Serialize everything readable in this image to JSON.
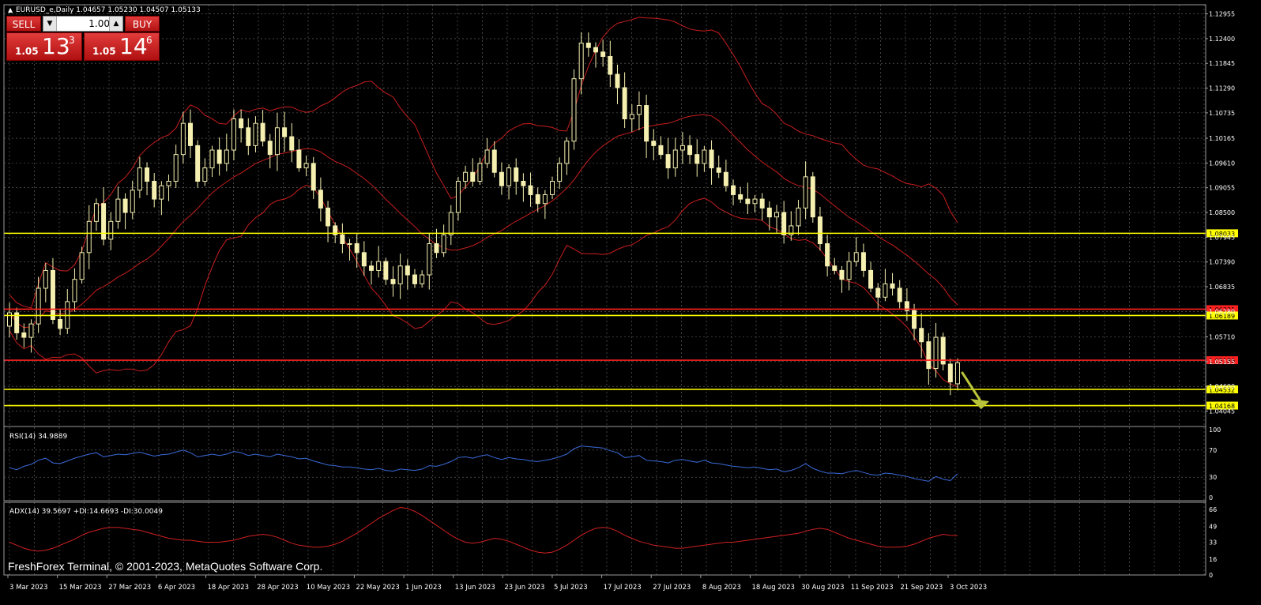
{
  "header": {
    "symbol_info": "EURUSD_e,Daily  1.04657 1.05230 1.04507 1.05133"
  },
  "trade_panel": {
    "sell_label": "SELL",
    "buy_label": "BUY",
    "lot_value": "1.00",
    "bid_prefix": "1.05",
    "bid_big": "13",
    "bid_sup": "3",
    "ask_prefix": "1.05",
    "ask_big": "14",
    "ask_sup": "6"
  },
  "watermark": "FreshForex Terminal, © 2001-2023, MetaQuotes Software Corp.",
  "colors": {
    "background": "#000000",
    "grid": "#6e6e6e",
    "candle": "#f5f0b0",
    "bands": "#c81e1e",
    "support": "#ffff00",
    "resistance": "#ff2020",
    "rsi_line": "#3a6ad8",
    "adx_line": "#d02020",
    "arrow": "#b9c43a"
  },
  "chart_data": {
    "type": "candlestick",
    "symbol": "EURUSD_e",
    "timeframe": "Daily",
    "ohlc_last": {
      "open": 1.04657,
      "high": 1.0523,
      "low": 1.04507,
      "close": 1.05133
    },
    "ylim": [
      1.0377,
      1.1316
    ],
    "y_ticks": [
      1.12955,
      1.124,
      1.11845,
      1.1129,
      1.10735,
      1.10165,
      1.0961,
      1.09055,
      1.085,
      1.07945,
      1.0739,
      1.06835,
      1.0628,
      1.0571,
      1.05155,
      1.046,
      1.04045
    ],
    "x_labels": [
      "3 Mar 2023",
      "15 Mar 2023",
      "27 Mar 2023",
      "6 Apr 2023",
      "18 Apr 2023",
      "28 Apr 2023",
      "10 May 2023",
      "22 May 2023",
      "1 Jun 2023",
      "13 Jun 2023",
      "23 Jun 2023",
      "5 Jul 2023",
      "17 Jul 2023",
      "27 Jul 2023",
      "8 Aug 2023",
      "18 Aug 2023",
      "30 Aug 2023",
      "11 Sep 2023",
      "21 Sep 2023",
      "3 Oct 2023"
    ],
    "horizontal_levels": [
      {
        "price": 1.08033,
        "label": "1.08033",
        "color": "#ffff00"
      },
      {
        "price": 1.06331,
        "label": "1.06331",
        "color": "#ff2020"
      },
      {
        "price": 1.06189,
        "label": "1.06189",
        "color": "#ffff00"
      },
      {
        "price": 1.05186,
        "label": "1.05186",
        "color": "#ff2020"
      },
      {
        "price": 1.04532,
        "label": "1.04532",
        "color": "#ffff00"
      },
      {
        "price": 1.04168,
        "label": "1.04168",
        "color": "#ffff00"
      }
    ],
    "closes": [
      1.0625,
      1.058,
      1.057,
      1.06,
      1.068,
      1.072,
      1.061,
      1.059,
      1.065,
      1.07,
      1.076,
      1.083,
      1.087,
      1.079,
      1.083,
      1.088,
      1.085,
      1.09,
      1.095,
      1.092,
      1.088,
      1.091,
      1.092,
      1.098,
      1.105,
      1.1,
      1.092,
      1.095,
      1.099,
      1.096,
      1.099,
      1.106,
      1.104,
      1.1,
      1.105,
      1.101,
      1.098,
      1.104,
      1.102,
      1.099,
      1.095,
      1.096,
      1.09,
      1.086,
      1.082,
      1.08,
      1.078,
      1.078,
      1.076,
      1.073,
      1.072,
      1.074,
      1.07,
      1.069,
      1.073,
      1.071,
      1.069,
      1.071,
      1.078,
      1.076,
      1.08,
      1.085,
      1.092,
      1.094,
      1.092,
      1.096,
      1.099,
      1.094,
      1.091,
      1.095,
      1.092,
      1.091,
      1.089,
      1.087,
      1.089,
      1.092,
      1.096,
      1.101,
      1.115,
      1.123,
      1.122,
      1.121,
      1.12,
      1.116,
      1.113,
      1.106,
      1.107,
      1.109,
      1.101,
      1.1,
      1.098,
      1.095,
      1.099,
      1.1,
      1.098,
      1.096,
      1.099,
      1.095,
      1.094,
      1.091,
      1.089,
      1.088,
      1.087,
      1.088,
      1.086,
      1.084,
      1.085,
      1.08,
      1.082,
      1.086,
      1.093,
      1.084,
      1.078,
      1.073,
      1.072,
      1.07,
      1.074,
      1.076,
      1.072,
      1.068,
      1.066,
      1.069,
      1.068,
      1.065,
      1.063,
      1.059,
      1.056,
      1.05,
      1.057,
      1.051,
      1.047,
      1.0513
    ],
    "indicators": [
      {
        "name": "Bollinger Bands",
        "color": "#c81e1e"
      },
      {
        "name": "RSI(14)",
        "label": "RSI(14) 34.9889",
        "value": 34.9889,
        "ylim": [
          0,
          100
        ],
        "ticks": [
          100,
          70,
          30,
          0
        ],
        "values": [
          44,
          41,
          46,
          49,
          55,
          58,
          51,
          50,
          54,
          58,
          61,
          64,
          66,
          60,
          62,
          64,
          63,
          65,
          67,
          64,
          61,
          63,
          64,
          67,
          70,
          66,
          60,
          62,
          64,
          62,
          64,
          68,
          66,
          62,
          64,
          62,
          60,
          64,
          62,
          60,
          57,
          58,
          54,
          51,
          48,
          47,
          45,
          45,
          44,
          42,
          41,
          43,
          40,
          39,
          42,
          41,
          40,
          42,
          47,
          46,
          49,
          53,
          59,
          60,
          58,
          61,
          63,
          59,
          56,
          59,
          57,
          56,
          54,
          53,
          55,
          57,
          60,
          64,
          72,
          76,
          75,
          74,
          73,
          69,
          66,
          59,
          60,
          62,
          55,
          54,
          53,
          51,
          55,
          56,
          54,
          52,
          55,
          51,
          50,
          48,
          46,
          45,
          44,
          45,
          43,
          41,
          42,
          38,
          40,
          44,
          50,
          43,
          39,
          36,
          36,
          35,
          38,
          40,
          37,
          34,
          33,
          36,
          35,
          33,
          31,
          28,
          26,
          24,
          31,
          27,
          25,
          35
        ]
      },
      {
        "name": "ADX(14)",
        "label": "ADX(14) 39.5697 +DI:14.6693 -DI:30.0049",
        "value": 39.5697,
        "plus_di": 14.6693,
        "minus_di": 30.0049,
        "ylim": [
          0,
          70
        ],
        "ticks": [
          66,
          49,
          33,
          16,
          0
        ],
        "values": [
          33,
          30,
          27,
          25,
          24,
          25,
          27,
          30,
          33,
          36,
          40,
          43,
          45,
          47,
          48,
          48,
          47,
          46,
          45,
          43,
          41,
          39,
          37,
          36,
          35,
          35,
          34,
          33,
          33,
          33,
          34,
          35,
          37,
          39,
          40,
          41,
          40,
          38,
          35,
          32,
          30,
          29,
          28,
          28,
          29,
          31,
          34,
          38,
          42,
          47,
          52,
          57,
          61,
          65,
          68,
          67,
          64,
          60,
          55,
          50,
          45,
          40,
          36,
          33,
          32,
          33,
          35,
          37,
          36,
          34,
          31,
          28,
          25,
          23,
          22,
          23,
          26,
          30,
          35,
          40,
          44,
          47,
          48,
          47,
          44,
          40,
          37,
          34,
          32,
          30,
          29,
          28,
          27,
          27,
          28,
          29,
          30,
          31,
          32,
          33,
          33,
          34,
          35,
          36,
          37,
          38,
          39,
          40,
          41,
          42,
          44,
          46,
          47,
          46,
          43,
          40,
          37,
          35,
          33,
          31,
          29,
          28,
          28,
          28,
          29,
          31,
          34,
          37,
          39,
          41,
          40,
          39.6
        ]
      }
    ]
  }
}
